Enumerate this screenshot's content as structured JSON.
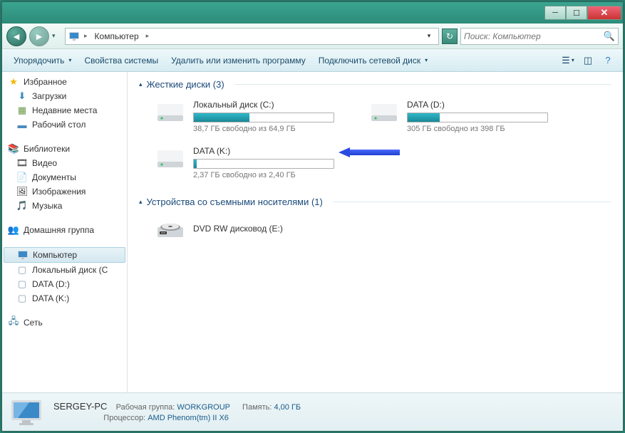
{
  "titlebar": {},
  "nav": {
    "breadcrumb_root": "Компьютер",
    "search_placeholder": "Поиск: Компьютер"
  },
  "toolbar": {
    "organize": "Упорядочить",
    "system_props": "Свойства системы",
    "uninstall": "Удалить или изменить программу",
    "map_drive": "Подключить сетевой диск"
  },
  "sidebar": {
    "favorites": {
      "label": "Избранное",
      "items": [
        {
          "label": "Загрузки",
          "icon": "download"
        },
        {
          "label": "Недавние места",
          "icon": "recent"
        },
        {
          "label": "Рабочий стол",
          "icon": "desktop"
        }
      ]
    },
    "libraries": {
      "label": "Библиотеки",
      "items": [
        {
          "label": "Видео",
          "icon": "video"
        },
        {
          "label": "Документы",
          "icon": "docs"
        },
        {
          "label": "Изображения",
          "icon": "images"
        },
        {
          "label": "Музыка",
          "icon": "music"
        }
      ]
    },
    "homegroup": {
      "label": "Домашняя группа"
    },
    "computer": {
      "label": "Компьютер",
      "items": [
        {
          "label": "Локальный диск (C"
        },
        {
          "label": "DATA (D:)"
        },
        {
          "label": "DATA (K:)"
        }
      ]
    },
    "network": {
      "label": "Сеть"
    }
  },
  "main": {
    "hdd_section": {
      "label": "Жесткие диски (3)"
    },
    "drives": [
      {
        "name": "Локальный диск (C:)",
        "stat": "38,7 ГБ свободно из 64,9 ГБ",
        "fill_pct": 40
      },
      {
        "name": "DATA (D:)",
        "stat": "305 ГБ свободно из 398 ГБ",
        "fill_pct": 23
      },
      {
        "name": "DATA (K:)",
        "stat": "2,37 ГБ свободно из 2,40 ГБ",
        "fill_pct": 1
      }
    ],
    "removable_section": {
      "label": "Устройства со съемными носителями (1)"
    },
    "removable": [
      {
        "name": "DVD RW дисковод (E:)"
      }
    ]
  },
  "details": {
    "name": "SERGEY-PC",
    "workgroup_k": "Рабочая группа:",
    "workgroup_v": "WORKGROUP",
    "cpu_k": "Процессор:",
    "cpu_v": "AMD Phenom(tm) II X6",
    "mem_k": "Память:",
    "mem_v": "4,00 ГБ"
  }
}
